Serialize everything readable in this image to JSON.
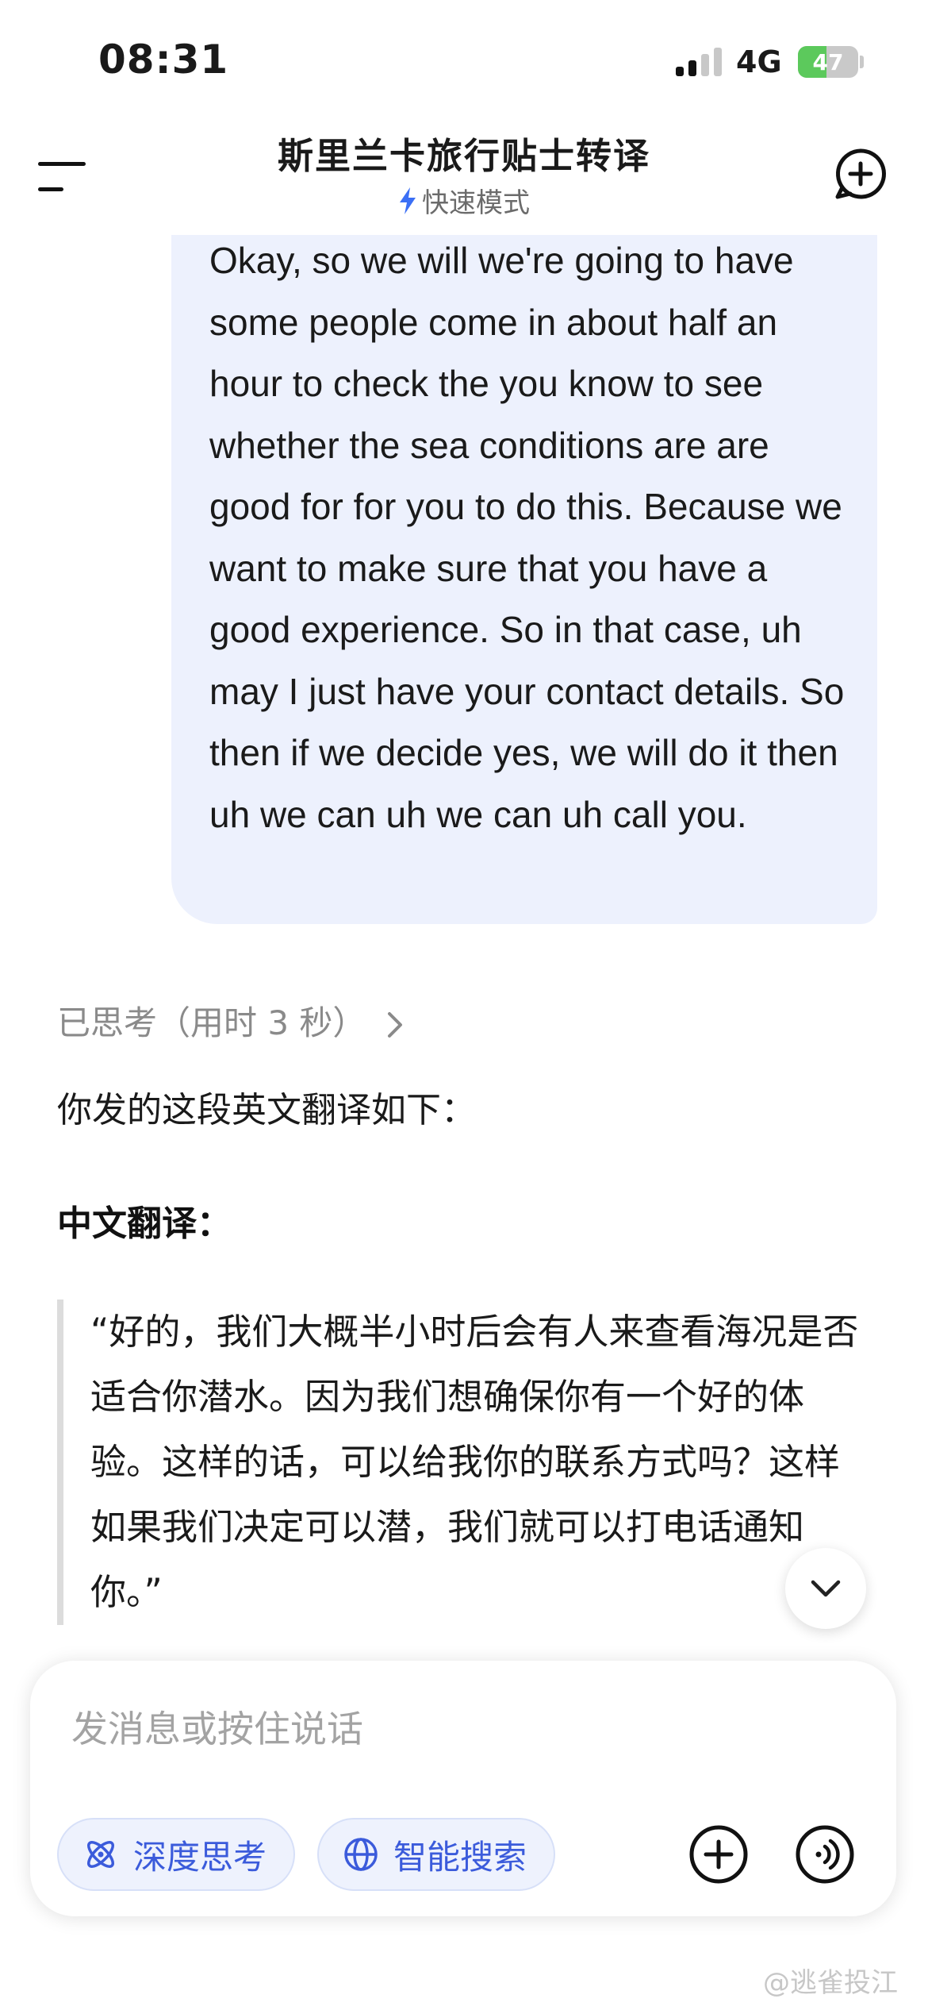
{
  "status_bar": {
    "time": "08:31",
    "network": "4G",
    "battery": "47",
    "battery_level": 0.47,
    "battery_color": "#5cc95c"
  },
  "header": {
    "title": "斯里兰卡旅行贴士转译",
    "mode_label": "快速模式",
    "menu_icon": "menu-icon",
    "new_chat_icon": "new-chat-icon"
  },
  "user_message": {
    "text": "Okay, so we will we're going to have some people come in about half an hour to check the you know to see whether the sea conditions are are good for for you to do this. Because we want to make sure that you have a good experience. So in that case, uh may I just have your contact details. So then if we decide yes, we will do it then uh we can uh we can uh call you."
  },
  "assistant": {
    "thinking_label": "已思考（用时 3 秒）",
    "intro": "你发的这段英文翻译如下：",
    "heading": "中文翻译：",
    "quote": "“好的，我们大概半小时后会有人来查看海况是否适合你潜水。因为我们想确保你有一个好的体验。这样的话，可以给我你的联系方式吗？这样如果我们决定可以潜，我们就可以打电话通知你。”"
  },
  "input": {
    "placeholder": "发消息或按住说话",
    "deep_think_label": "深度思考",
    "smart_search_label": "智能搜索"
  },
  "watermark": "@逃雀投江",
  "colors": {
    "accent": "#3b5bdb",
    "user_bubble": "#edf1fd"
  }
}
